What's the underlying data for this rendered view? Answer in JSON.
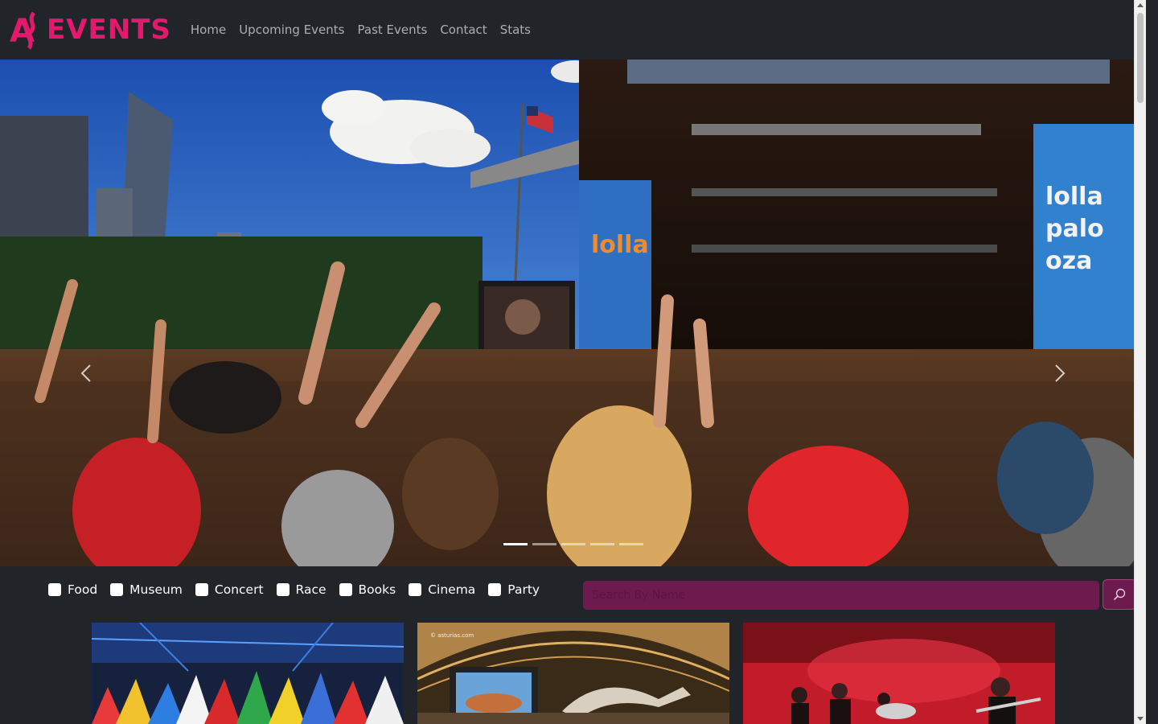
{
  "brand": {
    "logo_text": "EVENTS",
    "logo_initial": "A",
    "accent_color": "#e3196e"
  },
  "nav": {
    "links": [
      {
        "label": "Home"
      },
      {
        "label": "Upcoming Events"
      },
      {
        "label": "Past Events"
      },
      {
        "label": "Contact"
      },
      {
        "label": "Stats"
      }
    ]
  },
  "carousel": {
    "prev_icon": "chevron-left-icon",
    "next_icon": "chevron-right-icon",
    "slide_count": 5,
    "active_index": 0,
    "stage_banner_text": "lolla palo oza"
  },
  "filters": {
    "categories": [
      {
        "label": "Food",
        "checked": false
      },
      {
        "label": "Museum",
        "checked": false
      },
      {
        "label": "Concert",
        "checked": false
      },
      {
        "label": "Race",
        "checked": false
      },
      {
        "label": "Books",
        "checked": false
      },
      {
        "label": "Cinema",
        "checked": false
      },
      {
        "label": "Party",
        "checked": false
      }
    ],
    "search": {
      "placeholder": "Search By Name",
      "value": "",
      "icon": "search-icon"
    }
  },
  "cards": [
    {
      "image_name": "flags-event-image"
    },
    {
      "image_name": "museum-event-image",
      "watermark": "© asturias.com"
    },
    {
      "image_name": "concert-event-image"
    }
  ],
  "colors": {
    "navbar_bg": "#212529",
    "search_bg": "#6d1a4e",
    "nav_text": "rgba(255,255,255,0.62)"
  }
}
